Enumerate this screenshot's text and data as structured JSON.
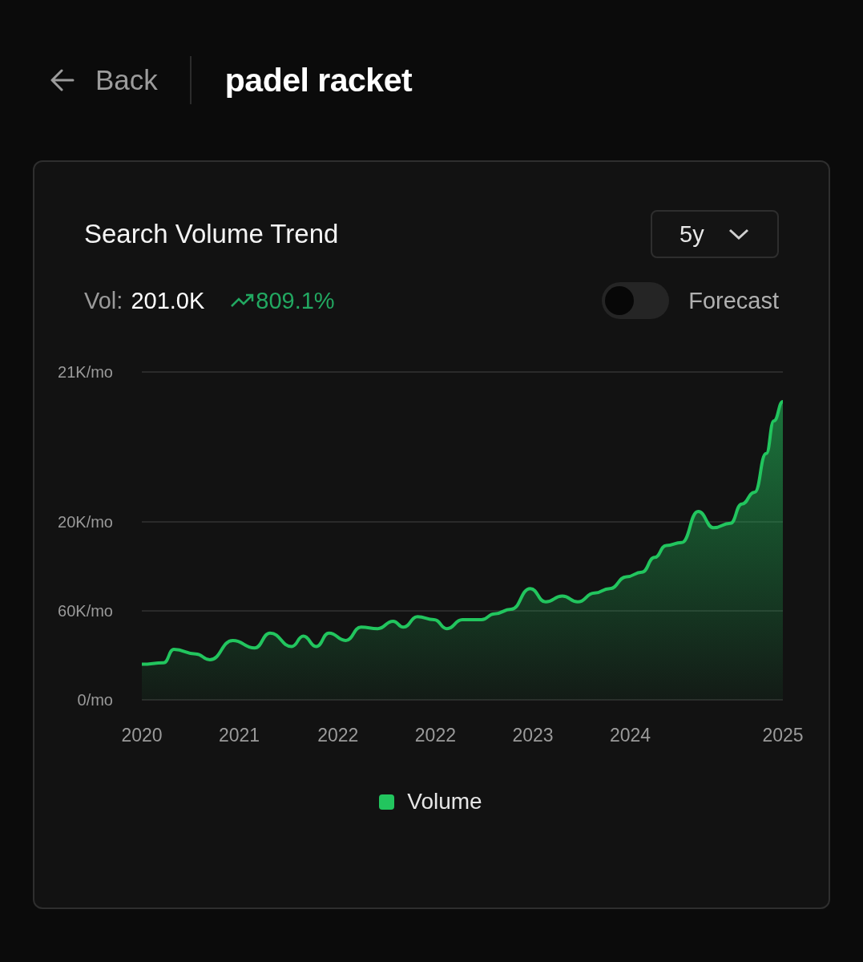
{
  "header": {
    "back_label": "Back",
    "title": "padel racket"
  },
  "card": {
    "title": "Search Volume Trend",
    "range_select": {
      "value": "5y"
    },
    "stats": {
      "label": "Vol:",
      "value": "201.0K",
      "change": "809.1%"
    },
    "forecast": {
      "label": "Forecast",
      "on": false
    },
    "clipped_axis_labels": [
      "21K/mo",
      "20K/mo"
    ],
    "chart_data": {
      "type": "area",
      "ylim": [
        0,
        221
      ],
      "xlim": [
        2020,
        2025
      ],
      "xticks": [
        {
          "value": 2020,
          "label": "2020"
        },
        {
          "value": 2020.76,
          "label": "2021"
        },
        {
          "value": 2021.53,
          "label": "2022"
        },
        {
          "value": 2022.29,
          "label": "2022"
        },
        {
          "value": 2023.05,
          "label": "2023"
        },
        {
          "value": 2023.81,
          "label": "2024"
        },
        {
          "value": 2025,
          "label": "2025"
        }
      ],
      "yticks": [
        {
          "value": 0,
          "label": "0/mo"
        },
        {
          "value": 60,
          "label": "60K/mo"
        }
      ],
      "x": [
        2020.0,
        2020.17,
        2020.25,
        2020.42,
        2020.53,
        2020.71,
        2020.88,
        2021.0,
        2021.17,
        2021.26,
        2021.36,
        2021.46,
        2021.59,
        2021.71,
        2021.84,
        2021.96,
        2022.04,
        2022.15,
        2022.28,
        2022.38,
        2022.5,
        2022.65,
        2022.75,
        2022.88,
        2023.03,
        2023.15,
        2023.28,
        2023.4,
        2023.53,
        2023.65,
        2023.78,
        2023.9,
        2024.0,
        2024.09,
        2024.21,
        2024.34,
        2024.46,
        2024.59,
        2024.68,
        2024.78,
        2024.87,
        2024.93,
        2025.0
      ],
      "series": [
        {
          "name": "Volume",
          "color": "#22c55e",
          "values": [
            24,
            25,
            34,
            31,
            27,
            40,
            35,
            45,
            36,
            43,
            36,
            45,
            40,
            49,
            48,
            53,
            49,
            56,
            54,
            48,
            54,
            54,
            58,
            61,
            75,
            66,
            70,
            66,
            72,
            75,
            83,
            86,
            96,
            104,
            106,
            127,
            116,
            119,
            132,
            140,
            166,
            188,
            201
          ]
        }
      ]
    }
  }
}
